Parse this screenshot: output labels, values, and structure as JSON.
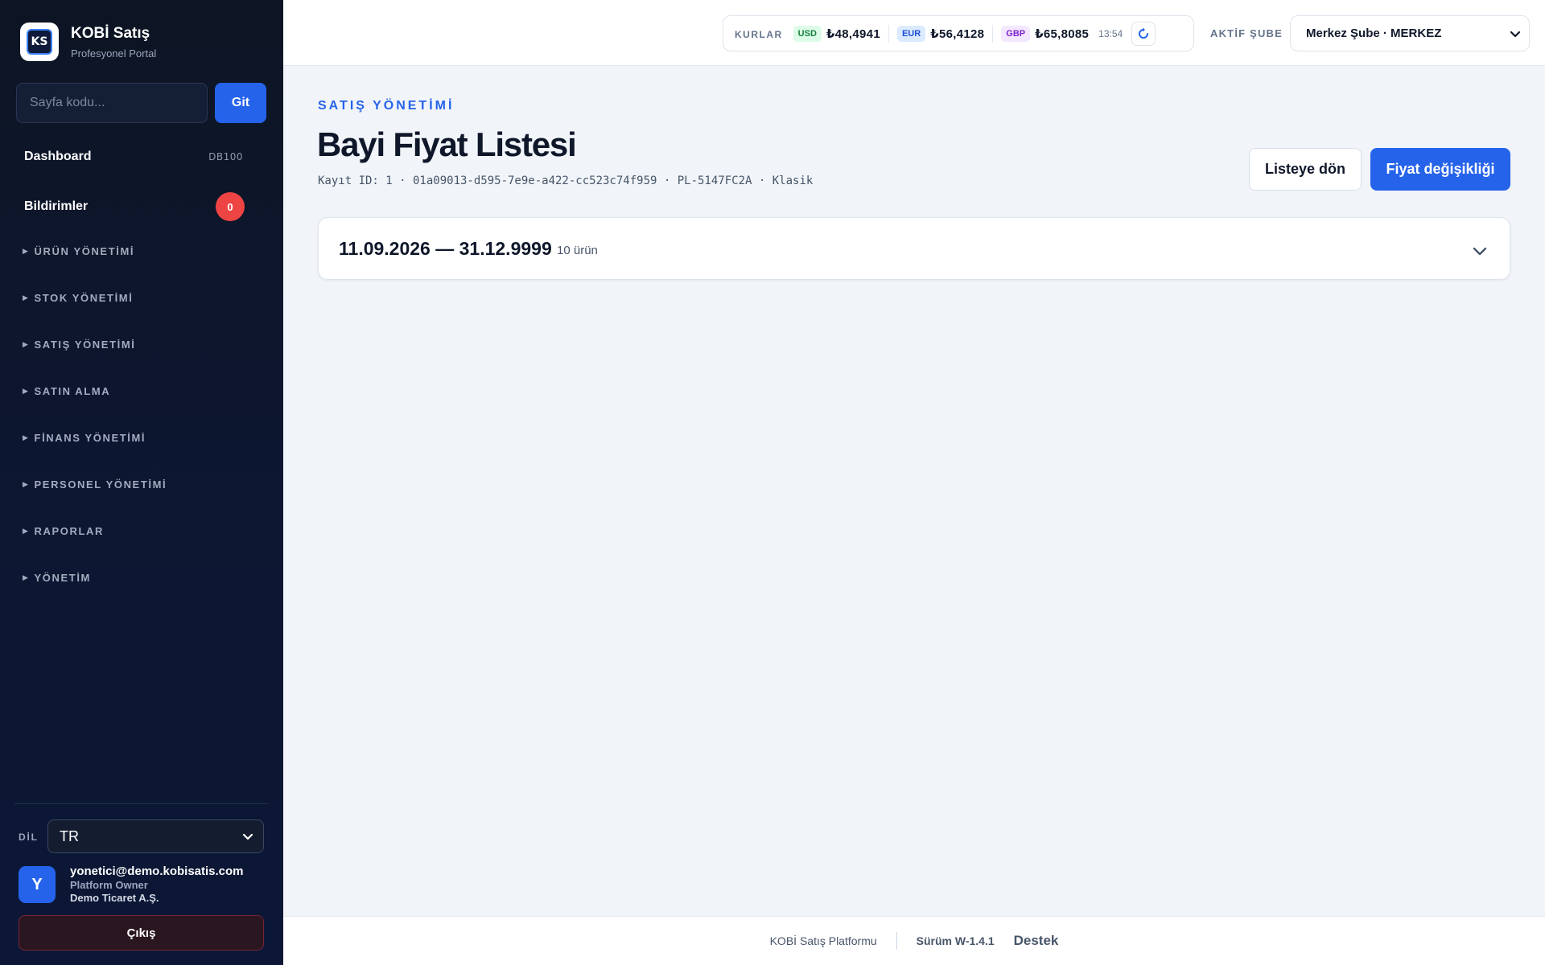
{
  "brand": {
    "title": "KOBİ Satış",
    "subtitle": "Profesyonel Portal",
    "logo_text": "KS"
  },
  "search": {
    "placeholder": "Sayfa kodu...",
    "go_label": "Git"
  },
  "nav": {
    "dashboard": {
      "label": "Dashboard",
      "code": "DB100"
    },
    "notifications": {
      "label": "Bildirimler",
      "count": "0"
    },
    "sections": [
      "ÜRÜN YÖNETİMİ",
      "STOK YÖNETİMİ",
      "SATIŞ YÖNETİMİ",
      "SATIN ALMA",
      "FİNANS YÖNETİMİ",
      "PERSONEL YÖNETİMİ",
      "RAPORLAR",
      "YÖNETİM"
    ]
  },
  "language": {
    "label": "DİL",
    "value": "TR"
  },
  "user": {
    "initial": "Y",
    "email": "yonetici@demo.kobisatis.com",
    "role": "Platform Owner",
    "company": "Demo Ticaret A.Ş.",
    "logout_label": "Çıkış"
  },
  "header": {
    "rates_label": "KURLAR",
    "rates": [
      {
        "code": "USD",
        "value": "₺48,4941"
      },
      {
        "code": "EUR",
        "value": "₺56,4128"
      },
      {
        "code": "GBP",
        "value": "₺65,8085"
      }
    ],
    "time": "13:54",
    "branch_label": "AKTİF ŞUBE",
    "branch_value": "Merkez Şube · MERKEZ"
  },
  "page": {
    "eyebrow": "SATIŞ YÖNETİMİ",
    "title": "Bayi Fiyat Listesi",
    "meta": "Kayıt ID: 1 · 01a09013-d595-7e9e-a422-cc523c74f959 · PL-5147FC2A · Klasik",
    "back_label": "Listeye dön",
    "price_change_label": "Fiyat değişikliği"
  },
  "period": {
    "range": "11.09.2026 — 31.12.9999",
    "count": "10 ürün"
  },
  "footer": {
    "platform": "KOBİ Satış Platformu",
    "version": "Sürüm W-1.4.1",
    "support": "Destek"
  },
  "colors": {
    "accent": "#2563eb",
    "sidebar": "#0d1524",
    "danger": "#ef4444"
  }
}
